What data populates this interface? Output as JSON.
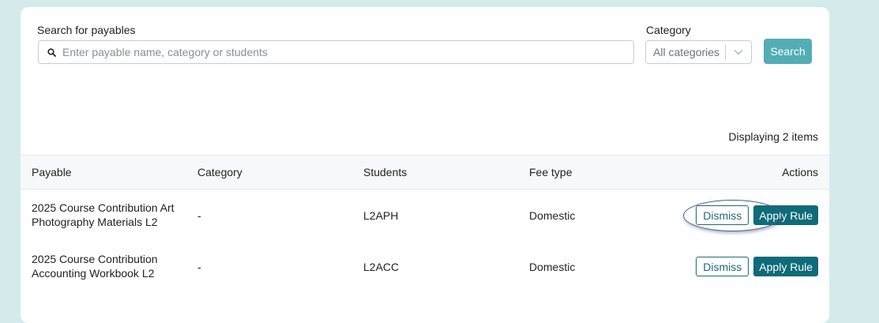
{
  "search": {
    "label": "Search for payables",
    "placeholder": "Enter payable name, category or students",
    "value": ""
  },
  "category": {
    "label": "Category",
    "selected": "All categories"
  },
  "search_button_label": "Search",
  "display_count": "Displaying 2 items",
  "table": {
    "headers": [
      "Payable",
      "Category",
      "Students",
      "Fee type",
      "Actions"
    ],
    "rows": [
      {
        "payable_line1": "2025 Course Contribution Art",
        "payable_line2": "Photography Materials L2",
        "category": "-",
        "students": "L2APH",
        "fee_type": "Domestic",
        "dismiss_label": "Dismiss",
        "apply_label": "Apply Rule"
      },
      {
        "payable_line1": "2025 Course Contribution",
        "payable_line2": "Accounting Workbook L2",
        "category": "-",
        "students": "L2ACC",
        "fee_type": "Domestic",
        "dismiss_label": "Dismiss",
        "apply_label": "Apply Rule"
      }
    ]
  },
  "icons": {
    "search": "search-icon",
    "dropdown": "chevron-down-icon"
  },
  "colors": {
    "background": "#d5ebeb",
    "search_button": "#52adb5",
    "primary": "#0e6b78",
    "dismiss_border": "#1d6b77"
  }
}
